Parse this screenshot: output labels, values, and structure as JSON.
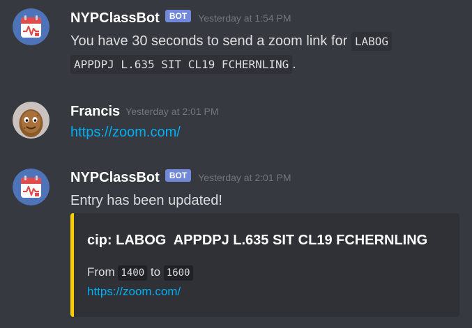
{
  "messages": [
    {
      "author": "NYPClassBot",
      "badge": "BOT",
      "timestamp": "Yesterday at 1:54 PM",
      "text_before": "You have 30 seconds to send a zoom link for ",
      "code_line1": "LABOG ",
      "code_line2": "APPDPJ L.635 SIT CL19 FCHERNLING",
      "text_after": ".",
      "avatar_icon": "calendar-icon"
    },
    {
      "author": "Francis",
      "timestamp": "Yesterday at 2:01 PM",
      "link": "https://zoom.com/",
      "avatar_icon": "potato-avatar"
    },
    {
      "author": "NYPClassBot",
      "badge": "BOT",
      "timestamp": "Yesterday at 2:01 PM",
      "text": "Entry has been updated!",
      "avatar_icon": "calendar-icon",
      "embed": {
        "title": "cip: LABOG  APPDPJ L.635 SIT CL19 FCHERNLING",
        "from_label": "From",
        "from_value": "1400",
        "to_label": "to",
        "to_value": "1600",
        "link": "https://zoom.com/",
        "accent_color": "#fccc00"
      }
    }
  ],
  "colors": {
    "background": "#36393f",
    "username": "#ffffff",
    "bot_badge": "#7289da",
    "link": "#00aff4",
    "timestamp": "#72767d"
  }
}
